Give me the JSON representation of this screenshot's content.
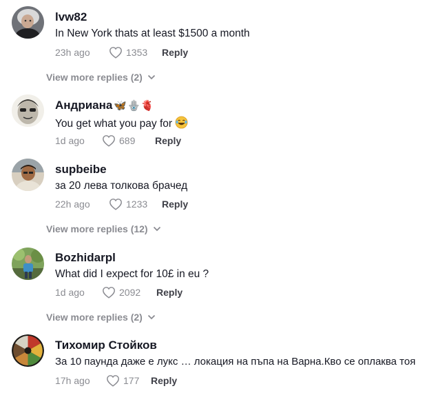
{
  "comments": [
    {
      "username": "lvw82",
      "text": "In New York thats at least $1500 a month",
      "time": "23h ago",
      "likes": "1353",
      "reply_label": "Reply",
      "view_more": "View more replies (2)"
    },
    {
      "username": "Андриана",
      "username_emojis": "🦋🪬🫀",
      "text": "You get what you pay for",
      "time": "1d ago",
      "likes": "689",
      "reply_label": "Reply"
    },
    {
      "username": "supbeibe",
      "text": "за 20 лева толкова брачед",
      "time": "22h ago",
      "likes": "1233",
      "reply_label": "Reply",
      "view_more": "View more replies (12)"
    },
    {
      "username": "Bozhidarpl",
      "text": "What did I expect for 10£ in eu ?",
      "time": "1d ago",
      "likes": "2092",
      "reply_label": "Reply",
      "view_more": "View more replies (2)"
    },
    {
      "username": "Тихомир Стойков",
      "text": "За 10 паунда даже е лукс … локация на пъпа на Варна.Кво се оплаква тоя",
      "time": "17h ago",
      "likes": "177",
      "reply_label": "Reply"
    }
  ],
  "icons": {
    "like": "heart-outline-icon",
    "expand": "chevron-down-icon",
    "emoji": "tears-of-joy-emoji"
  },
  "colors": {
    "primary_text": "#161823",
    "secondary_text": "#8a8b91",
    "reply_text": "#3e3f47"
  }
}
